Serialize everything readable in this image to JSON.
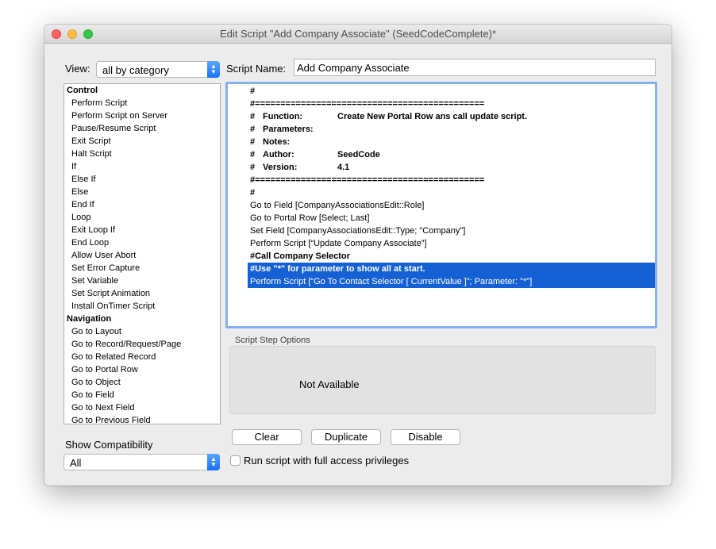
{
  "window": {
    "title": "Edit Script \"Add Company Associate\" (SeedCodeComplete)*"
  },
  "view": {
    "label": "View:",
    "selected": "all by category"
  },
  "script_name": {
    "label": "Script Name:",
    "value": "Add Company Associate"
  },
  "step_list": [
    {
      "text": "Control",
      "category": true
    },
    {
      "text": "Perform Script",
      "category": false
    },
    {
      "text": "Perform Script on Server",
      "category": false
    },
    {
      "text": "Pause/Resume Script",
      "category": false
    },
    {
      "text": "Exit Script",
      "category": false
    },
    {
      "text": "Halt Script",
      "category": false
    },
    {
      "text": "If",
      "category": false
    },
    {
      "text": "Else If",
      "category": false
    },
    {
      "text": "Else",
      "category": false
    },
    {
      "text": "End If",
      "category": false
    },
    {
      "text": "Loop",
      "category": false
    },
    {
      "text": "Exit Loop If",
      "category": false
    },
    {
      "text": "End Loop",
      "category": false
    },
    {
      "text": "Allow User Abort",
      "category": false
    },
    {
      "text": "Set Error Capture",
      "category": false
    },
    {
      "text": "Set Variable",
      "category": false
    },
    {
      "text": "Set Script Animation",
      "category": false
    },
    {
      "text": "Install OnTimer Script",
      "category": false
    },
    {
      "text": "Navigation",
      "category": true
    },
    {
      "text": "Go to Layout",
      "category": false
    },
    {
      "text": "Go to Record/Request/Page",
      "category": false
    },
    {
      "text": "Go to Related Record",
      "category": false
    },
    {
      "text": "Go to Portal Row",
      "category": false
    },
    {
      "text": "Go to Object",
      "category": false
    },
    {
      "text": "Go to Field",
      "category": false
    },
    {
      "text": "Go to Next Field",
      "category": false
    },
    {
      "text": "Go to Previous Field",
      "category": false
    }
  ],
  "script_lines": [
    {
      "mark": "#",
      "key": "",
      "val": "",
      "text": "",
      "bold": true,
      "selected": false
    },
    {
      "mark": "",
      "key": "",
      "val": "",
      "text": "#=============================================",
      "bold": true,
      "selected": false
    },
    {
      "mark": "#",
      "key": "Function:",
      "val": "Create New Portal Row ans call update script.",
      "text": "",
      "bold": true,
      "selected": false
    },
    {
      "mark": "#",
      "key": "Parameters:",
      "val": "",
      "text": "",
      "bold": true,
      "selected": false
    },
    {
      "mark": "#",
      "key": "Notes:",
      "val": "",
      "text": "",
      "bold": true,
      "selected": false
    },
    {
      "mark": "#",
      "key": "Author:",
      "val": "SeedCode",
      "text": "",
      "bold": true,
      "selected": false
    },
    {
      "mark": "#",
      "key": "Version:",
      "val": " 4.1",
      "text": "",
      "bold": true,
      "selected": false
    },
    {
      "mark": "",
      "key": "",
      "val": "",
      "text": "#=============================================",
      "bold": true,
      "selected": false
    },
    {
      "mark": "#",
      "key": "",
      "val": "",
      "text": "",
      "bold": true,
      "selected": false
    },
    {
      "mark": "",
      "key": "",
      "val": "",
      "text": "Go to Field [CompanyAssociationsEdit::Role]",
      "bold": false,
      "selected": false
    },
    {
      "mark": "",
      "key": "",
      "val": "",
      "text": "Go to Portal Row [Select; Last]",
      "bold": false,
      "selected": false
    },
    {
      "mark": "",
      "key": "",
      "val": "",
      "text": "Set Field [CompanyAssociationsEdit::Type; \"Company\"]",
      "bold": false,
      "selected": false
    },
    {
      "mark": "",
      "key": "",
      "val": "",
      "text": "Perform Script [“Update Company Associate”]",
      "bold": false,
      "selected": false
    },
    {
      "mark": "",
      "key": "",
      "val": "",
      "text": "#Call Company Selector",
      "bold": true,
      "selected": false
    },
    {
      "mark": "",
      "key": "",
      "val": "",
      "text": "#Use \"*\" for parameter to show all at start.",
      "bold": true,
      "selected": true
    },
    {
      "mark": "",
      "key": "",
      "val": "",
      "text": "Perform Script [“Go To Contact Selector [ CurrentValue ]”; Parameter: \"*\"]",
      "bold": false,
      "selected": true
    }
  ],
  "step_options": {
    "label": "Script Step Options",
    "status": "Not Available"
  },
  "show_compat": {
    "label": "Show Compatibility",
    "selected": "All"
  },
  "buttons": {
    "clear": "Clear",
    "duplicate": "Duplicate",
    "disable": "Disable"
  },
  "full_access": {
    "label": "Run script with full access privileges",
    "checked": false
  },
  "colors": {
    "selection": "#1560d4",
    "focus_ring": "#84b2ee",
    "popup_accent": "#1a6ff5"
  }
}
